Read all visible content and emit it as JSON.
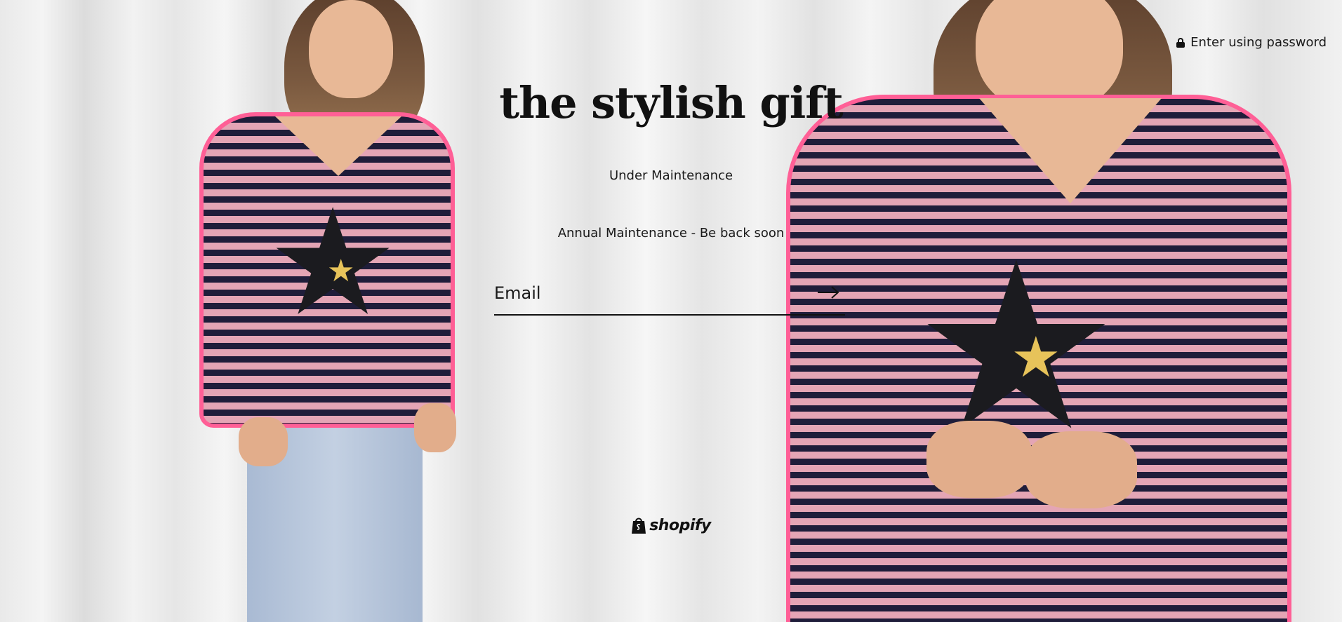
{
  "header": {
    "password_link": "Enter using password"
  },
  "brand": {
    "name": "the stylish gift"
  },
  "main": {
    "headline": "Under Maintenance",
    "message": "Annual Maintenance - Be back soon"
  },
  "form": {
    "email_placeholder": "Email",
    "email_value": "",
    "submit_icon": "arrow-right-icon"
  },
  "footer": {
    "powered_by": "shopify"
  },
  "colors": {
    "stripe_navy": "#1f1d3a",
    "stripe_pink": "#e4a5b5",
    "trim_pink": "#ff5f96",
    "star_gold": "#e7c35a"
  }
}
